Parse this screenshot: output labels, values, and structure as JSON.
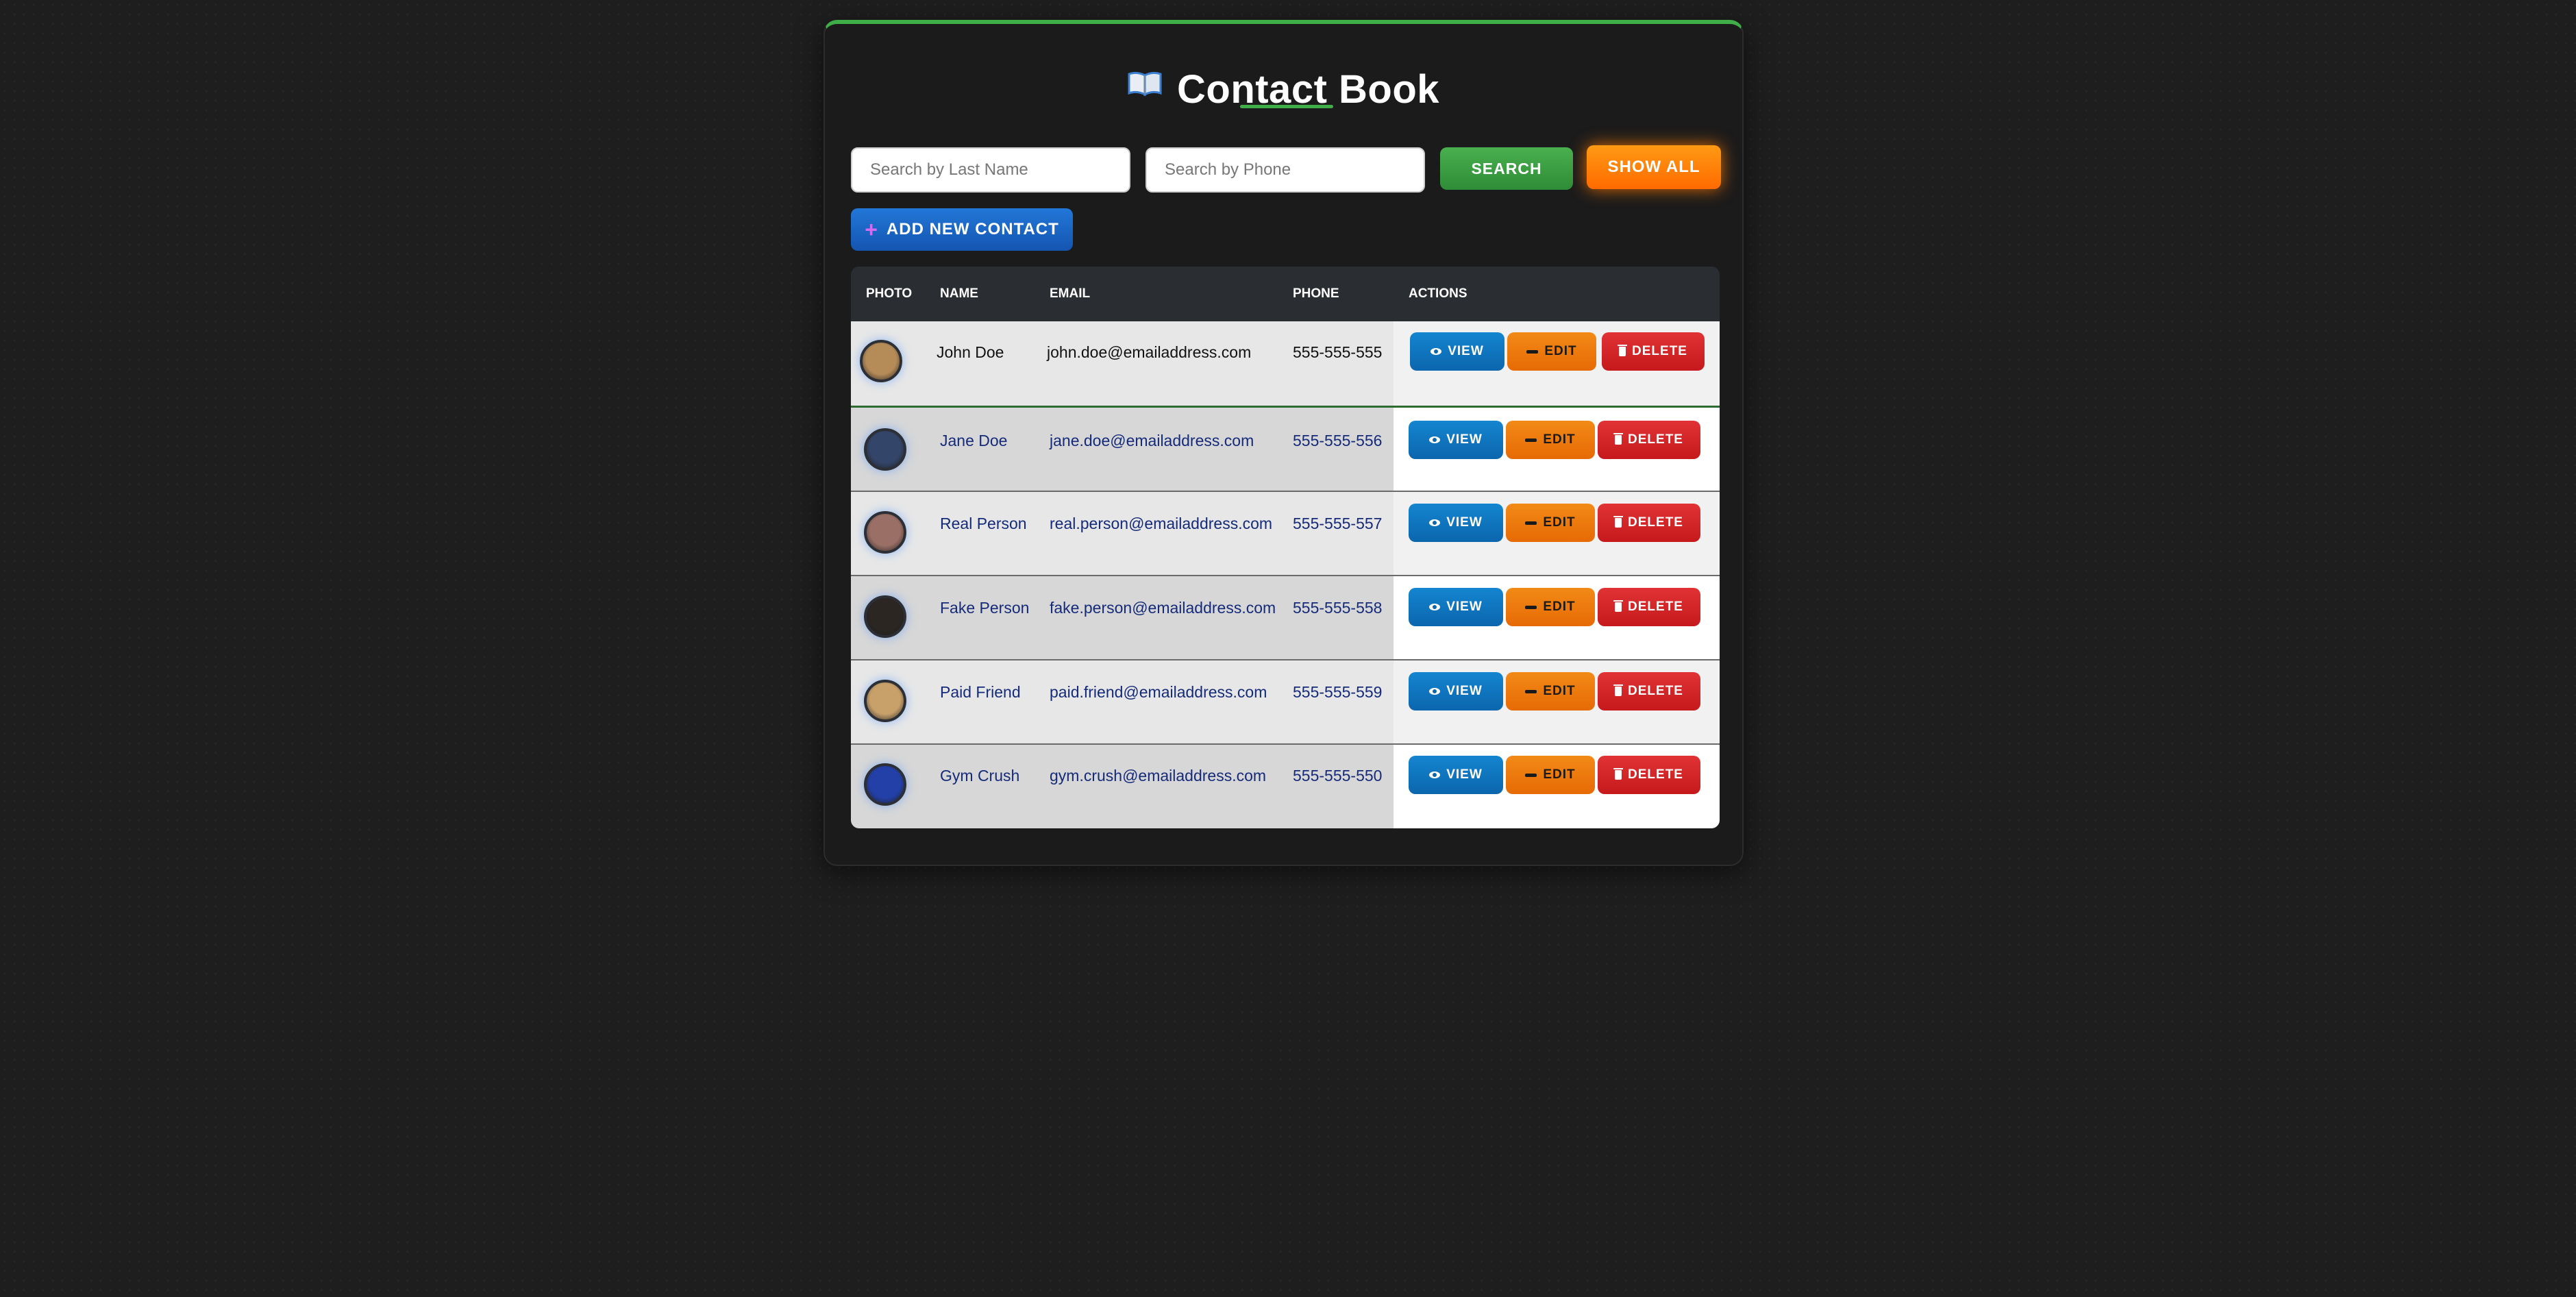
{
  "app": {
    "title": "Contact Book",
    "title_icon": "open-book-icon"
  },
  "search": {
    "last_name_placeholder": "Search by Last Name",
    "last_name_value": "",
    "phone_placeholder": "Search by Phone",
    "phone_value": "",
    "search_label": "SEARCH",
    "show_all_label": "SHOW ALL"
  },
  "add_contact": {
    "icon": "plus-icon",
    "label": "ADD NEW CONTACT"
  },
  "table": {
    "headers": [
      "PHOTO",
      "NAME",
      "EMAIL",
      "PHONE",
      "ACTIONS"
    ],
    "actions": {
      "view": "VIEW",
      "edit": "EDIT",
      "delete": "DELETE"
    },
    "rows": [
      {
        "name": "John Doe",
        "email": "john.doe@emailaddress.com",
        "phone": "555-555-555",
        "avatar_color": "#b58b58"
      },
      {
        "name": "Jane Doe",
        "email": "jane.doe@emailaddress.com",
        "phone": "555-555-556",
        "avatar_color": "#34456a"
      },
      {
        "name": "Real Person",
        "email": "real.person@emailaddress.com",
        "phone": "555-555-557",
        "avatar_color": "#9a6f66"
      },
      {
        "name": "Fake Person",
        "email": "fake.person@emailaddress.com",
        "phone": "555-555-558",
        "avatar_color": "#2b2622"
      },
      {
        "name": "Paid Friend",
        "email": "paid.friend@emailaddress.com",
        "phone": "555-555-559",
        "avatar_color": "#c7a06a"
      },
      {
        "name": "Gym Crush",
        "email": "gym.crush@emailaddress.com",
        "phone": "555-555-550",
        "avatar_color": "#2340a8"
      }
    ]
  },
  "colors": {
    "accent_green": "#3fae49",
    "show_all_orange": "#ff7a00",
    "add_blue": "#1a66c4",
    "view_blue": "#0f75c0",
    "edit_orange": "#ee7a0d",
    "delete_red": "#d32427"
  }
}
